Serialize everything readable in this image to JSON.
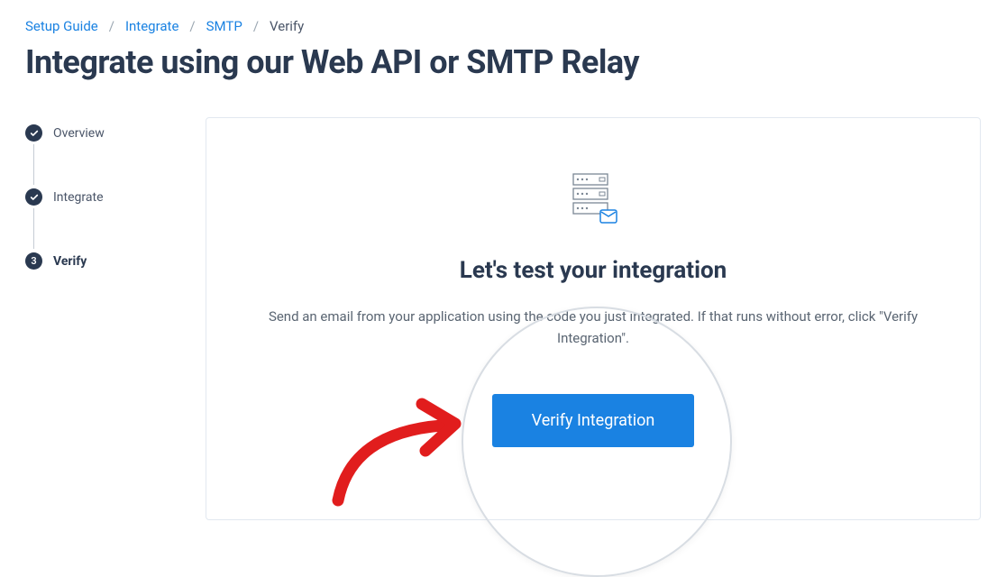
{
  "breadcrumb": {
    "items": [
      {
        "label": "Setup Guide",
        "link": true
      },
      {
        "label": "Integrate",
        "link": true
      },
      {
        "label": "SMTP",
        "link": true
      },
      {
        "label": "Verify",
        "link": false
      }
    ]
  },
  "page_title": "Integrate using our Web API or SMTP Relay",
  "sidebar": {
    "steps": [
      {
        "label": "Overview",
        "state": "done"
      },
      {
        "label": "Integrate",
        "state": "done"
      },
      {
        "label": "Verify",
        "state": "current",
        "number": "3"
      }
    ]
  },
  "panel": {
    "heading": "Let's test your integration",
    "description": "Send an email from your application using the code you just integrated. If that runs without error, click \"Verify Integration\".",
    "verify_button": "Verify Integration"
  }
}
